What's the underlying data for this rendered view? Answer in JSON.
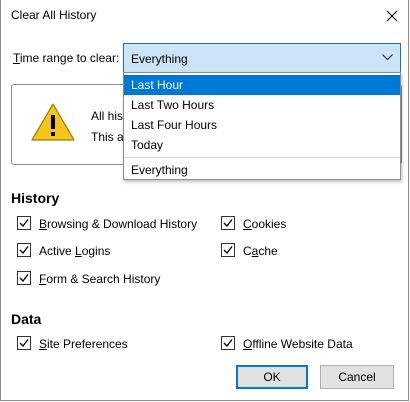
{
  "window": {
    "title": "Clear All History"
  },
  "time_range": {
    "label_hotkey": "T",
    "label_rest": "ime range to clear:",
    "selected_value": "Everything",
    "options": [
      "Last Hour",
      "Last Two Hours",
      "Last Four Hours",
      "Today",
      "Everything"
    ],
    "highlighted_option": "Last Hour"
  },
  "warning": {
    "line1_visible": "All his",
    "line2_visible": "This ac"
  },
  "history": {
    "title": "History",
    "items": [
      {
        "hotkey": "B",
        "rest": "rowsing & Download History",
        "checked": true
      },
      {
        "hotkey": "C",
        "rest": "ookies",
        "checked": true
      },
      {
        "pre": "Active ",
        "hotkey": "L",
        "rest": "ogins",
        "checked": true
      },
      {
        "pre": "C",
        "hotkey": "a",
        "rest": "che",
        "checked": true
      },
      {
        "hotkey": "F",
        "rest": "orm & Search History",
        "checked": true
      }
    ]
  },
  "data": {
    "title": "Data",
    "items": [
      {
        "hotkey": "S",
        "rest": "ite Preferences",
        "checked": true
      },
      {
        "hotkey": "O",
        "rest": "ffline Website Data",
        "checked": true
      }
    ]
  },
  "buttons": {
    "ok": "OK",
    "cancel": "Cancel"
  },
  "colors": {
    "accent": "#0078d7",
    "select_bg": "#cce4f7",
    "warning_yellow": "#f5c518"
  }
}
